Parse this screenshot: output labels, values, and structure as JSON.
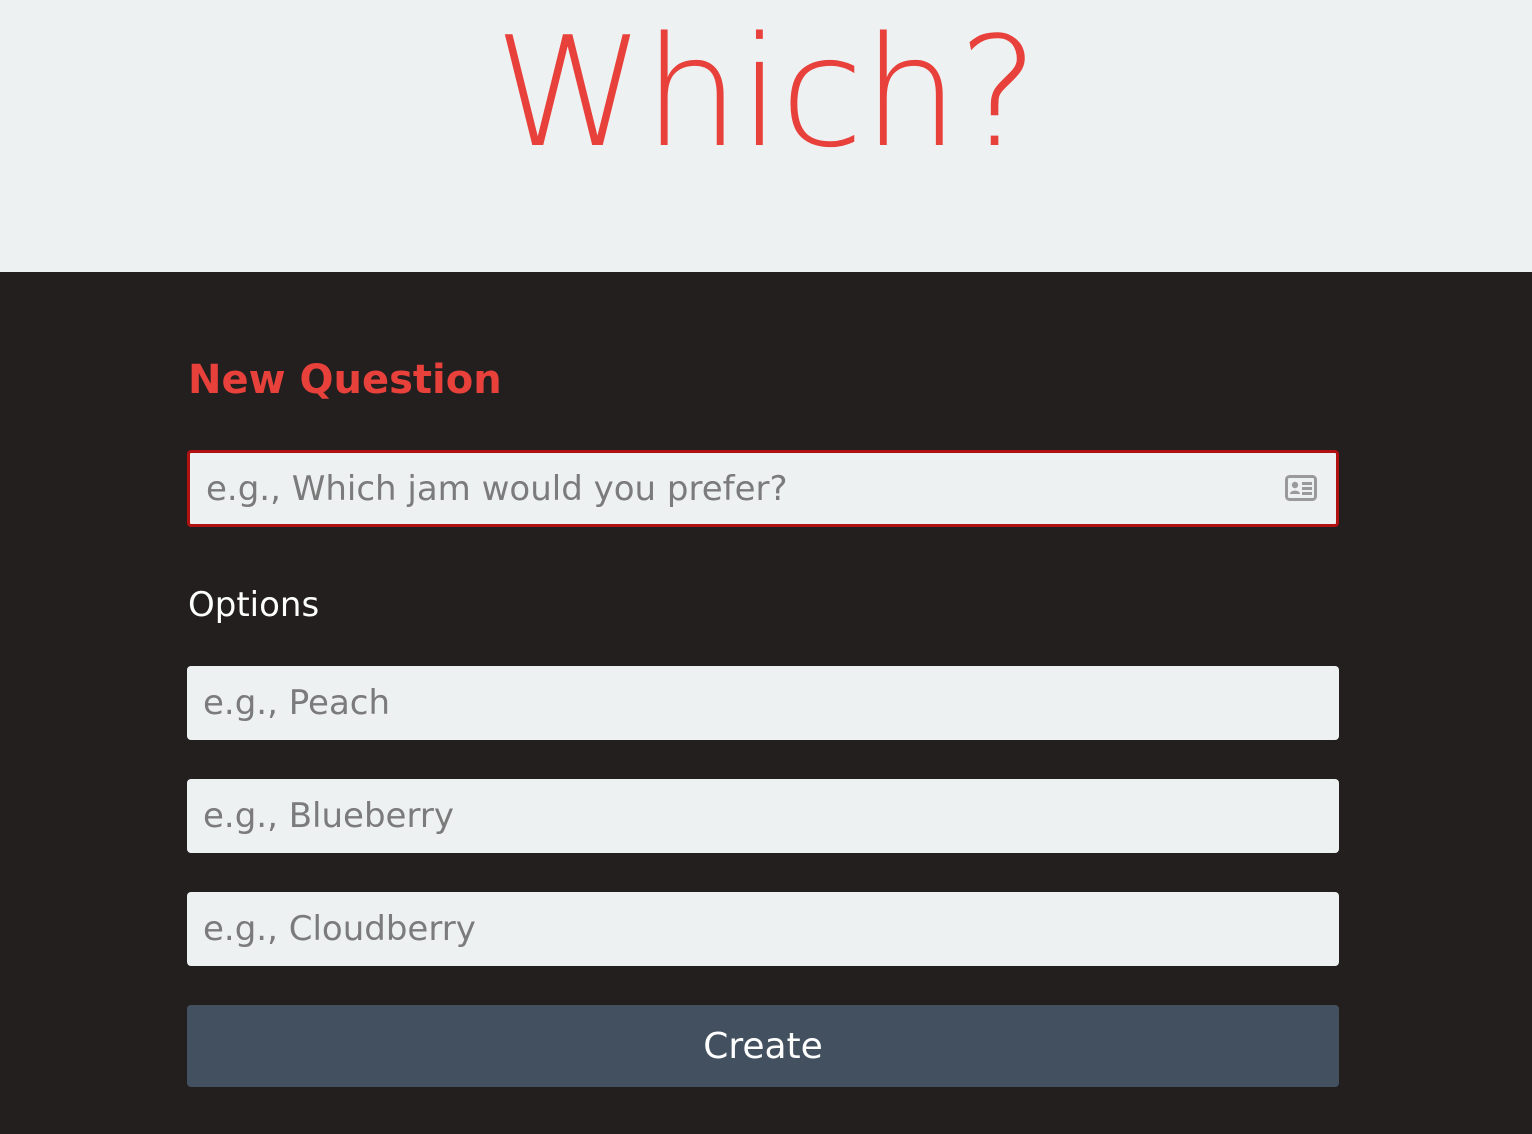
{
  "header": {
    "title": "Which?"
  },
  "form": {
    "heading": "New Question",
    "question": {
      "value": "",
      "placeholder": "e.g., Which jam would you prefer?",
      "icon": "contact-card-icon"
    },
    "options_label": "Options",
    "options": [
      {
        "value": "",
        "placeholder": "e.g., Peach"
      },
      {
        "value": "",
        "placeholder": "e.g., Blueberry"
      },
      {
        "value": "",
        "placeholder": "e.g., Cloudberry"
      }
    ],
    "submit_label": "Create"
  },
  "colors": {
    "accent": "#e8403a",
    "header_bg": "#eef1f2",
    "body_bg": "#231f1f",
    "button_bg": "#435060",
    "focus_border": "#b01212"
  }
}
